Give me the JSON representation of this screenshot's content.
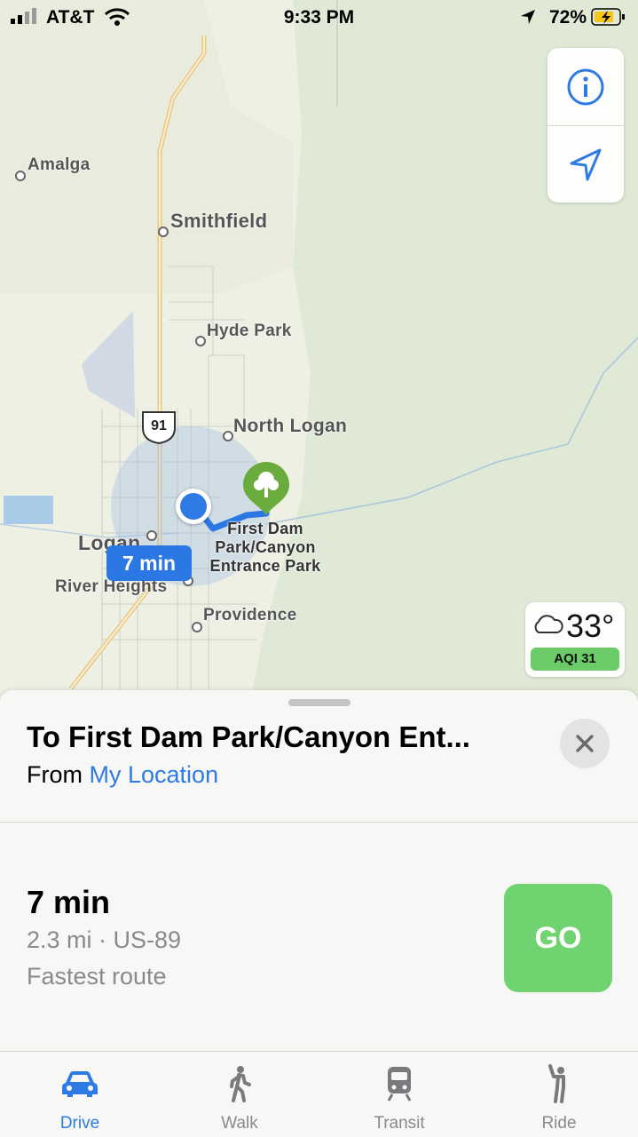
{
  "status_bar": {
    "carrier": "AT&T",
    "time": "9:33 PM",
    "battery": "72%"
  },
  "map": {
    "cities": [
      "Amalga",
      "Smithfield",
      "Hyde Park",
      "North Logan",
      "Logan",
      "River Heights",
      "Providence"
    ],
    "highway_shield": "91",
    "poi": {
      "name": "First Dam Park/Canyon Entrance Park",
      "label_lines": [
        "First Dam",
        "Park/Canyon",
        "Entrance Park"
      ]
    },
    "route_badge": "7 min",
    "weather": {
      "temperature": "33°",
      "aqi": "AQI 31"
    }
  },
  "sheet": {
    "destination": "To First Dam Park/Canyon Ent...",
    "from_prefix": "From",
    "from_location": "My Location",
    "route": {
      "time": "7 min",
      "info": "2.3 mi · US-89",
      "note": "Fastest route"
    },
    "go_label": "GO"
  },
  "tabs": [
    {
      "label": "Drive",
      "active": true
    },
    {
      "label": "Walk",
      "active": false
    },
    {
      "label": "Transit",
      "active": false
    },
    {
      "label": "Ride",
      "active": false
    }
  ],
  "colors": {
    "accent": "#2f7be5",
    "go": "#6fd46f",
    "aqi": "#6ccb69",
    "route": "#2b77e4"
  }
}
